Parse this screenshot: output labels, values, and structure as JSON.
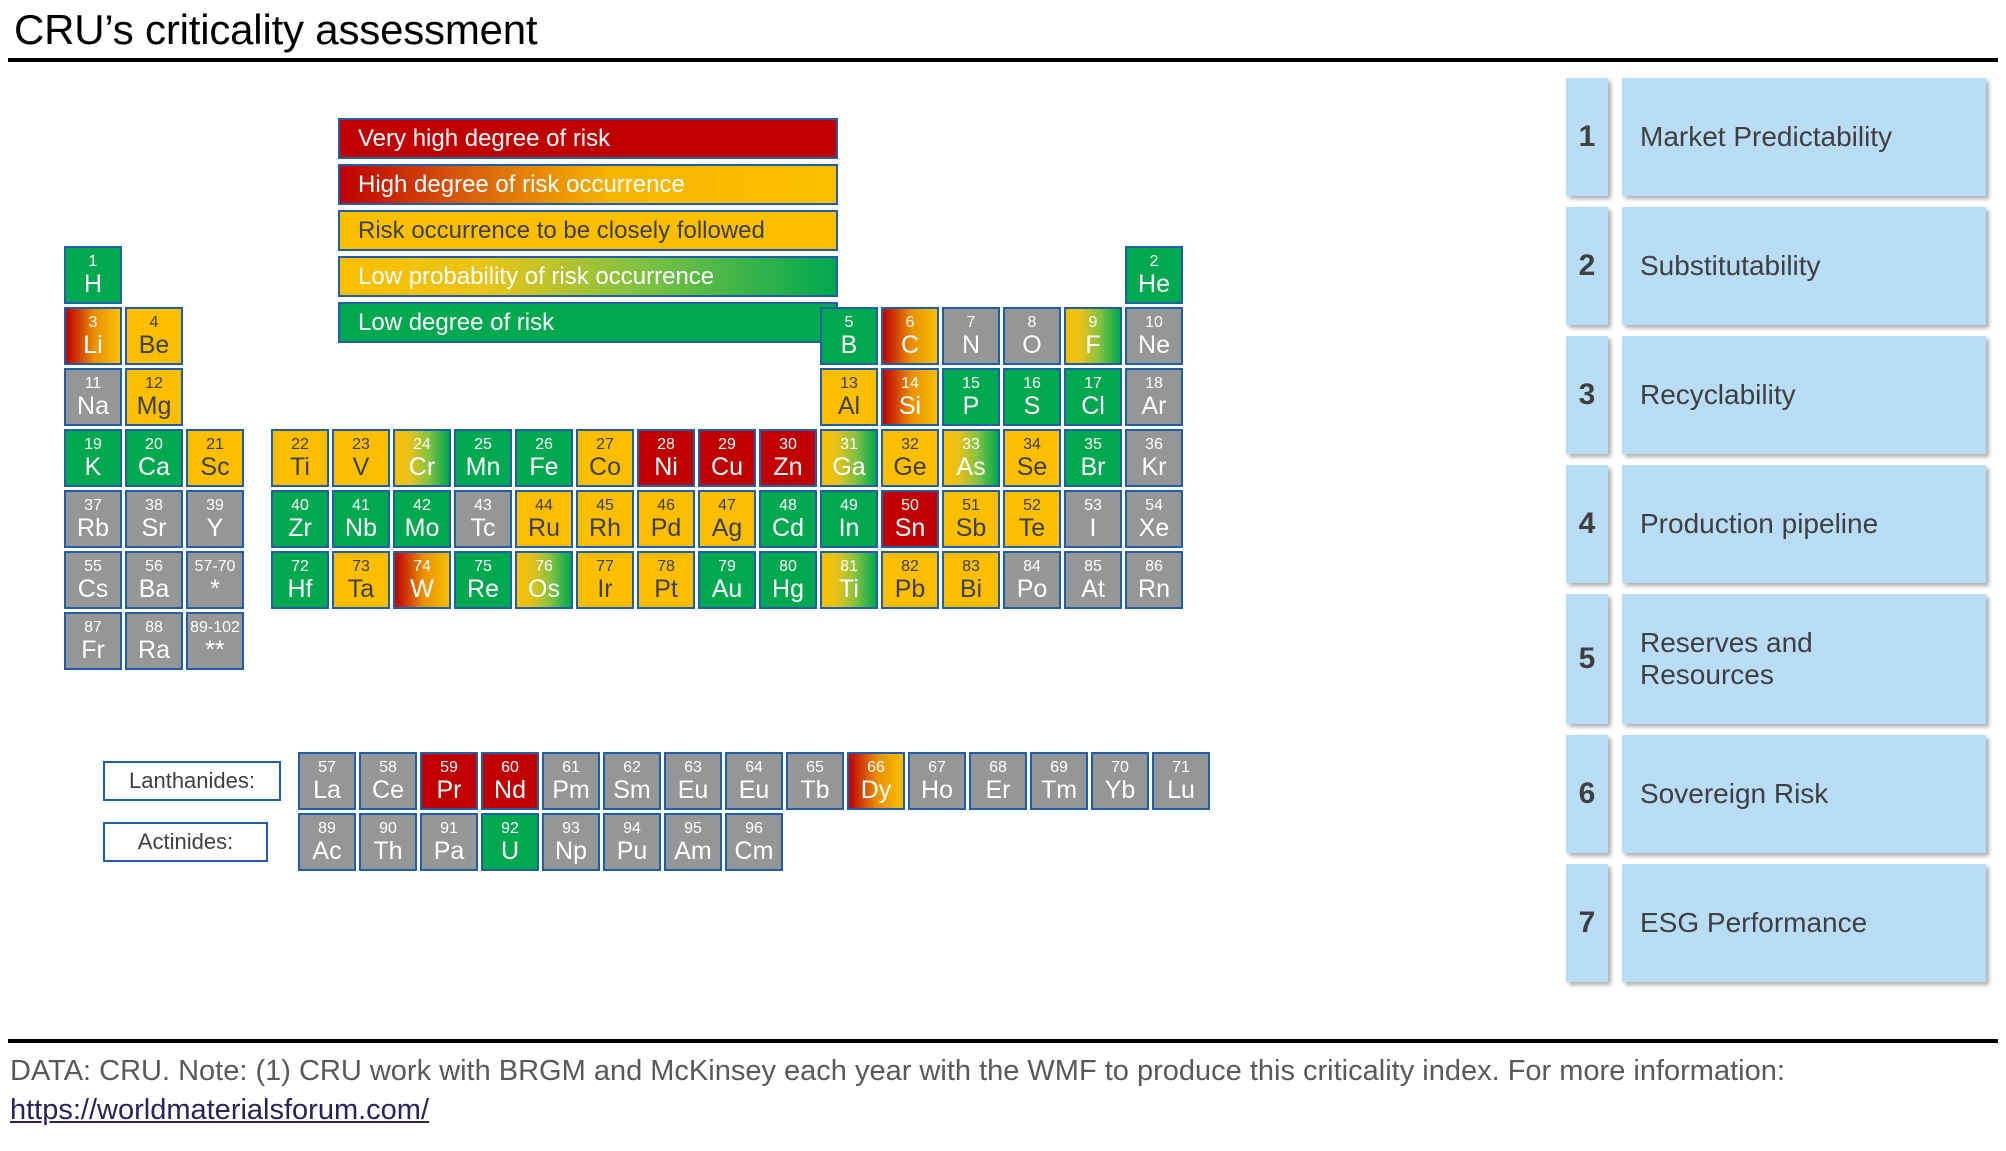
{
  "title": "CRU’s criticality assessment",
  "legend": {
    "items": [
      {
        "label": "Very high degree of risk",
        "level": "vhigh"
      },
      {
        "label": "High degree of risk occurrence",
        "level": "high"
      },
      {
        "label": "Risk occurrence to be closely followed",
        "level": "close"
      },
      {
        "label": "Low probability of risk occurrence",
        "level": "lowp"
      },
      {
        "label": "Low degree of risk",
        "level": "low"
      }
    ]
  },
  "colors": {
    "very_high_risk": "#c00000",
    "high_risk": "#e98f04",
    "closely_followed": "#fbbf00",
    "low_probability": "#86c241",
    "low_risk": "#00a84f",
    "not_assessed": "#969696",
    "tile_border": "#1f5fa9",
    "sidebar_fill": "#b9dcf7",
    "link": "#29235c"
  },
  "series_labels": {
    "lanthanides": "Lanthanides:",
    "actinides": "Actinides:"
  },
  "periodic_table": {
    "main": [
      {
        "num": "1",
        "sym": "H",
        "group": 1,
        "period": 1,
        "risk": "low"
      },
      {
        "num": "2",
        "sym": "He",
        "group": 18,
        "period": 1,
        "risk": "low"
      },
      {
        "num": "3",
        "sym": "Li",
        "group": 1,
        "period": 2,
        "risk": "high"
      },
      {
        "num": "4",
        "sym": "Be",
        "group": 2,
        "period": 2,
        "risk": "close"
      },
      {
        "num": "5",
        "sym": "B",
        "group": 13,
        "period": 2,
        "risk": "low"
      },
      {
        "num": "6",
        "sym": "C",
        "group": 14,
        "period": 2,
        "risk": "high"
      },
      {
        "num": "7",
        "sym": "N",
        "group": 15,
        "period": 2,
        "risk": "na"
      },
      {
        "num": "8",
        "sym": "O",
        "group": 16,
        "period": 2,
        "risk": "na"
      },
      {
        "num": "9",
        "sym": "F",
        "group": 17,
        "period": 2,
        "risk": "lowp"
      },
      {
        "num": "10",
        "sym": "Ne",
        "group": 18,
        "period": 2,
        "risk": "na"
      },
      {
        "num": "11",
        "sym": "Na",
        "group": 1,
        "period": 3,
        "risk": "na"
      },
      {
        "num": "12",
        "sym": "Mg",
        "group": 2,
        "period": 3,
        "risk": "close"
      },
      {
        "num": "13",
        "sym": "Al",
        "group": 13,
        "period": 3,
        "risk": "close"
      },
      {
        "num": "14",
        "sym": "Si",
        "group": 14,
        "period": 3,
        "risk": "high"
      },
      {
        "num": "15",
        "sym": "P",
        "group": 15,
        "period": 3,
        "risk": "low"
      },
      {
        "num": "16",
        "sym": "S",
        "group": 16,
        "period": 3,
        "risk": "low"
      },
      {
        "num": "17",
        "sym": "Cl",
        "group": 17,
        "period": 3,
        "risk": "low"
      },
      {
        "num": "18",
        "sym": "Ar",
        "group": 18,
        "period": 3,
        "risk": "na"
      },
      {
        "num": "19",
        "sym": "K",
        "group": 1,
        "period": 4,
        "risk": "low"
      },
      {
        "num": "20",
        "sym": "Ca",
        "group": 2,
        "period": 4,
        "risk": "low"
      },
      {
        "num": "21",
        "sym": "Sc",
        "group": 3,
        "period": 4,
        "risk": "close"
      },
      {
        "num": "22",
        "sym": "Ti",
        "group": 4,
        "period": 4,
        "risk": "close"
      },
      {
        "num": "23",
        "sym": "V",
        "group": 5,
        "period": 4,
        "risk": "close"
      },
      {
        "num": "24",
        "sym": "Cr",
        "group": 6,
        "period": 4,
        "risk": "lowp"
      },
      {
        "num": "25",
        "sym": "Mn",
        "group": 7,
        "period": 4,
        "risk": "low"
      },
      {
        "num": "26",
        "sym": "Fe",
        "group": 8,
        "period": 4,
        "risk": "low"
      },
      {
        "num": "27",
        "sym": "Co",
        "group": 9,
        "period": 4,
        "risk": "close"
      },
      {
        "num": "28",
        "sym": "Ni",
        "group": 10,
        "period": 4,
        "risk": "vhigh"
      },
      {
        "num": "29",
        "sym": "Cu",
        "group": 11,
        "period": 4,
        "risk": "vhigh"
      },
      {
        "num": "30",
        "sym": "Zn",
        "group": 12,
        "period": 4,
        "risk": "vhigh"
      },
      {
        "num": "31",
        "sym": "Ga",
        "group": 13,
        "period": 4,
        "risk": "lowp"
      },
      {
        "num": "32",
        "sym": "Ge",
        "group": 14,
        "period": 4,
        "risk": "close"
      },
      {
        "num": "33",
        "sym": "As",
        "group": 15,
        "period": 4,
        "risk": "lowp"
      },
      {
        "num": "34",
        "sym": "Se",
        "group": 16,
        "period": 4,
        "risk": "close"
      },
      {
        "num": "35",
        "sym": "Br",
        "group": 17,
        "period": 4,
        "risk": "low"
      },
      {
        "num": "36",
        "sym": "Kr",
        "group": 18,
        "period": 4,
        "risk": "na"
      },
      {
        "num": "37",
        "sym": "Rb",
        "group": 1,
        "period": 5,
        "risk": "na"
      },
      {
        "num": "38",
        "sym": "Sr",
        "group": 2,
        "period": 5,
        "risk": "na"
      },
      {
        "num": "39",
        "sym": "Y",
        "group": 3,
        "period": 5,
        "risk": "na"
      },
      {
        "num": "40",
        "sym": "Zr",
        "group": 4,
        "period": 5,
        "risk": "low"
      },
      {
        "num": "41",
        "sym": "Nb",
        "group": 5,
        "period": 5,
        "risk": "low"
      },
      {
        "num": "42",
        "sym": "Mo",
        "group": 6,
        "period": 5,
        "risk": "low"
      },
      {
        "num": "43",
        "sym": "Tc",
        "group": 7,
        "period": 5,
        "risk": "na"
      },
      {
        "num": "44",
        "sym": "Ru",
        "group": 8,
        "period": 5,
        "risk": "close"
      },
      {
        "num": "45",
        "sym": "Rh",
        "group": 9,
        "period": 5,
        "risk": "close"
      },
      {
        "num": "46",
        "sym": "Pd",
        "group": 10,
        "period": 5,
        "risk": "close"
      },
      {
        "num": "47",
        "sym": "Ag",
        "group": 11,
        "period": 5,
        "risk": "close"
      },
      {
        "num": "48",
        "sym": "Cd",
        "group": 12,
        "period": 5,
        "risk": "low"
      },
      {
        "num": "49",
        "sym": "In",
        "group": 13,
        "period": 5,
        "risk": "low"
      },
      {
        "num": "50",
        "sym": "Sn",
        "group": 14,
        "period": 5,
        "risk": "vhigh"
      },
      {
        "num": "51",
        "sym": "Sb",
        "group": 15,
        "period": 5,
        "risk": "close"
      },
      {
        "num": "52",
        "sym": "Te",
        "group": 16,
        "period": 5,
        "risk": "close"
      },
      {
        "num": "53",
        "sym": "I",
        "group": 17,
        "period": 5,
        "risk": "na"
      },
      {
        "num": "54",
        "sym": "Xe",
        "group": 18,
        "period": 5,
        "risk": "na"
      },
      {
        "num": "55",
        "sym": "Cs",
        "group": 1,
        "period": 6,
        "risk": "na"
      },
      {
        "num": "56",
        "sym": "Ba",
        "group": 2,
        "period": 6,
        "risk": "na"
      },
      {
        "num": "57-70",
        "sym": "*",
        "group": 3,
        "period": 6,
        "risk": "na"
      },
      {
        "num": "72",
        "sym": "Hf",
        "group": 4,
        "period": 6,
        "risk": "low"
      },
      {
        "num": "73",
        "sym": "Ta",
        "group": 5,
        "period": 6,
        "risk": "close"
      },
      {
        "num": "74",
        "sym": "W",
        "group": 6,
        "period": 6,
        "risk": "high"
      },
      {
        "num": "75",
        "sym": "Re",
        "group": 7,
        "period": 6,
        "risk": "low"
      },
      {
        "num": "76",
        "sym": "Os",
        "group": 8,
        "period": 6,
        "risk": "lowp"
      },
      {
        "num": "77",
        "sym": "Ir",
        "group": 9,
        "period": 6,
        "risk": "close"
      },
      {
        "num": "78",
        "sym": "Pt",
        "group": 10,
        "period": 6,
        "risk": "close"
      },
      {
        "num": "79",
        "sym": "Au",
        "group": 11,
        "period": 6,
        "risk": "low"
      },
      {
        "num": "80",
        "sym": "Hg",
        "group": 12,
        "period": 6,
        "risk": "low"
      },
      {
        "num": "81",
        "sym": "Ti",
        "group": 13,
        "period": 6,
        "risk": "lowp"
      },
      {
        "num": "82",
        "sym": "Pb",
        "group": 14,
        "period": 6,
        "risk": "close"
      },
      {
        "num": "83",
        "sym": "Bi",
        "group": 15,
        "period": 6,
        "risk": "close"
      },
      {
        "num": "84",
        "sym": "Po",
        "group": 16,
        "period": 6,
        "risk": "na"
      },
      {
        "num": "85",
        "sym": "At",
        "group": 17,
        "period": 6,
        "risk": "na"
      },
      {
        "num": "86",
        "sym": "Rn",
        "group": 18,
        "period": 6,
        "risk": "na"
      },
      {
        "num": "87",
        "sym": "Fr",
        "group": 1,
        "period": 7,
        "risk": "na"
      },
      {
        "num": "88",
        "sym": "Ra",
        "group": 2,
        "period": 7,
        "risk": "na"
      },
      {
        "num": "89-102",
        "sym": "**",
        "group": 3,
        "period": 7,
        "risk": "na"
      }
    ],
    "lanthanides": [
      {
        "num": "57",
        "sym": "La",
        "risk": "na"
      },
      {
        "num": "58",
        "sym": "Ce",
        "risk": "na"
      },
      {
        "num": "59",
        "sym": "Pr",
        "risk": "vhigh"
      },
      {
        "num": "60",
        "sym": "Nd",
        "risk": "vhigh"
      },
      {
        "num": "61",
        "sym": "Pm",
        "risk": "na"
      },
      {
        "num": "62",
        "sym": "Sm",
        "risk": "na"
      },
      {
        "num": "63",
        "sym": "Eu",
        "risk": "na"
      },
      {
        "num": "64",
        "sym": "Eu",
        "risk": "na"
      },
      {
        "num": "65",
        "sym": "Tb",
        "risk": "na"
      },
      {
        "num": "66",
        "sym": "Dy",
        "risk": "high"
      },
      {
        "num": "67",
        "sym": "Ho",
        "risk": "na"
      },
      {
        "num": "68",
        "sym": "Er",
        "risk": "na"
      },
      {
        "num": "69",
        "sym": "Tm",
        "risk": "na"
      },
      {
        "num": "70",
        "sym": "Yb",
        "risk": "na"
      },
      {
        "num": "71",
        "sym": "Lu",
        "risk": "na"
      }
    ],
    "actinides": [
      {
        "num": "89",
        "sym": "Ac",
        "risk": "na"
      },
      {
        "num": "90",
        "sym": "Th",
        "risk": "na"
      },
      {
        "num": "91",
        "sym": "Pa",
        "risk": "na"
      },
      {
        "num": "92",
        "sym": "U",
        "risk": "low"
      },
      {
        "num": "93",
        "sym": "Np",
        "risk": "na"
      },
      {
        "num": "94",
        "sym": "Pu",
        "risk": "na"
      },
      {
        "num": "95",
        "sym": "Am",
        "risk": "na"
      },
      {
        "num": "96",
        "sym": "Cm",
        "risk": "na"
      }
    ]
  },
  "criteria": [
    {
      "number": "1",
      "label": "Market Predictability"
    },
    {
      "number": "2",
      "label": "Substitutability"
    },
    {
      "number": "3",
      "label": "Recyclability"
    },
    {
      "number": "4",
      "label": "Production pipeline"
    },
    {
      "number": "5",
      "label": "Reserves and\nResources"
    },
    {
      "number": "6",
      "label": "Sovereign Risk"
    },
    {
      "number": "7",
      "label": "ESG Performance"
    }
  ],
  "footer": {
    "text_before": "DATA: CRU. Note: (1) CRU work with BRGM and McKinsey each year with the WMF to produce this criticality index. For more information: ",
    "link_text": "https://worldmaterialsforum.com/"
  }
}
